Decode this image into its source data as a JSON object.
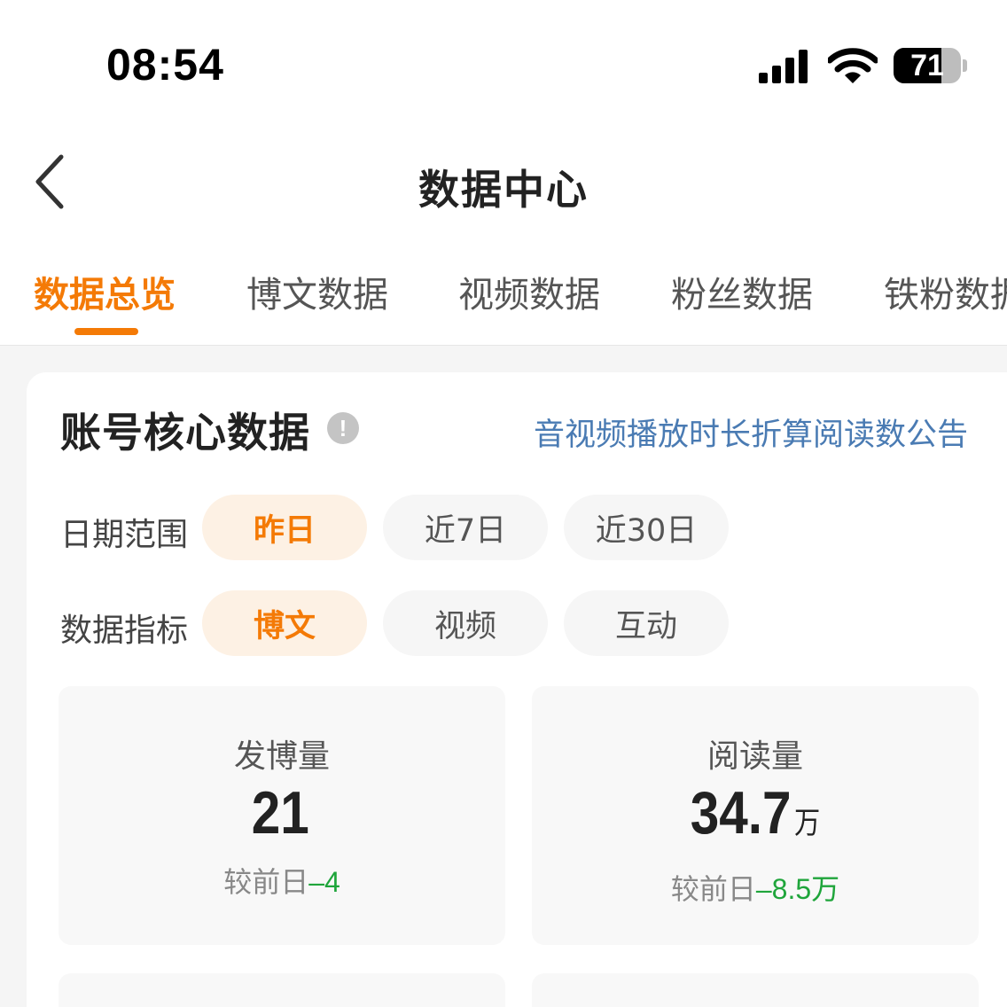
{
  "status_bar": {
    "time": "08:54",
    "battery": "71",
    "battery_level": 0.71
  },
  "nav": {
    "title": "数据中心",
    "back_icon": "chevron-left-icon"
  },
  "tabs": [
    {
      "label": "数据总览",
      "active": true
    },
    {
      "label": "博文数据",
      "active": false
    },
    {
      "label": "视频数据",
      "active": false
    },
    {
      "label": "粉丝数据",
      "active": false
    },
    {
      "label": "铁粉数据",
      "active": false
    }
  ],
  "core": {
    "title": "账号核心数据",
    "info_icon": "exclamation-circle-icon",
    "notice_link": "音视频播放时长折算阅读数公告"
  },
  "filters": {
    "date": {
      "label": "日期范围",
      "options": [
        "昨日",
        "近7日",
        "近30日"
      ],
      "selected": "昨日"
    },
    "metric": {
      "label": "数据指标",
      "options": [
        "博文",
        "视频",
        "互动"
      ],
      "selected": "博文"
    }
  },
  "stats": [
    {
      "label": "发博量",
      "value": "21",
      "unit": "",
      "compare_label": "较前日",
      "delta": "–4"
    },
    {
      "label": "阅读量",
      "value": "34.7",
      "unit": "万",
      "compare_label": "较前日",
      "delta": "–8.5万"
    }
  ],
  "colors": {
    "accent": "#f47a06",
    "link": "#4a7bb3",
    "delta_negative": "#1fa53b"
  }
}
